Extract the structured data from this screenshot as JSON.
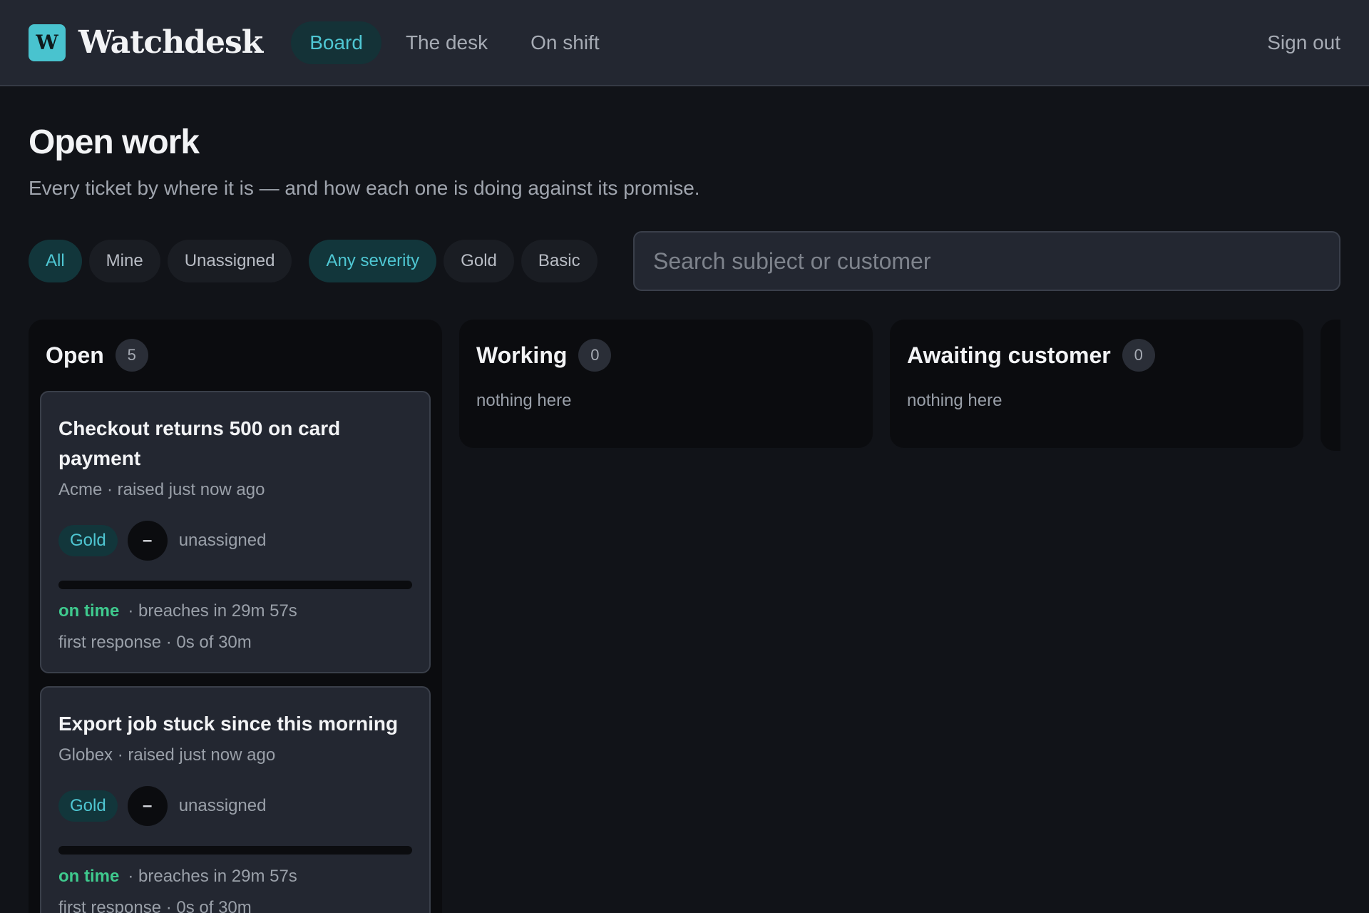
{
  "app": {
    "logo_letter": "W",
    "brand": "Watchdesk",
    "nav": [
      {
        "label": "Board",
        "active": true
      },
      {
        "label": "The desk",
        "active": false
      },
      {
        "label": "On shift",
        "active": false
      }
    ],
    "sign_out": "Sign out"
  },
  "page": {
    "title": "Open work",
    "subtitle": "Every ticket by where it is — and how each one is doing against its promise."
  },
  "filters": {
    "assignment": [
      {
        "label": "All",
        "active": true
      },
      {
        "label": "Mine",
        "active": false
      },
      {
        "label": "Unassigned",
        "active": false
      }
    ],
    "severity": [
      {
        "label": "Any severity",
        "active": true
      },
      {
        "label": "Gold",
        "active": false
      },
      {
        "label": "Basic",
        "active": false
      }
    ],
    "search_placeholder": "Search subject or customer"
  },
  "columns": [
    {
      "title": "Open",
      "count": "5",
      "cards": [
        {
          "title": "Checkout returns 500 on card payment",
          "meta": "Acme · raised just now ago",
          "tier": "Gold",
          "avatar": "–",
          "assignee": "unassigned",
          "progress": 0,
          "status": "on time",
          "breach": "· breaches in 29m 57s",
          "first_response": "first response · 0s of 30m"
        },
        {
          "title": "Export job stuck since this morning",
          "meta": "Globex · raised just now ago",
          "tier": "Gold",
          "avatar": "–",
          "assignee": "unassigned",
          "progress": 0,
          "status": "on time",
          "breach": "· breaches in 29m 57s",
          "first_response": "first response · 0s of 30m"
        }
      ]
    },
    {
      "title": "Working",
      "count": "0",
      "empty": "nothing here"
    },
    {
      "title": "Awaiting customer",
      "count": "0",
      "empty": "nothing here"
    }
  ],
  "colors": {
    "accent": "#4fc7d3",
    "on_time": "#3fca8e",
    "background": "#111318",
    "surface": "#232731"
  }
}
